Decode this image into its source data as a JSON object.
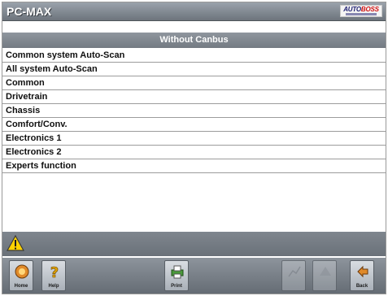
{
  "app": {
    "title": "PC-MAX",
    "brand": {
      "name_part1": "AUTO",
      "name_part2": "BOSS"
    }
  },
  "section": {
    "title": "Without Canbus"
  },
  "menu": {
    "items": [
      {
        "label": "Common system Auto-Scan"
      },
      {
        "label": "All system Auto-Scan"
      },
      {
        "label": "Common"
      },
      {
        "label": "Drivetrain"
      },
      {
        "label": "Chassis"
      },
      {
        "label": "Comfort/Conv."
      },
      {
        "label": "Electronics 1"
      },
      {
        "label": "Electronics 2"
      },
      {
        "label": "Experts function"
      }
    ]
  },
  "status": {
    "icon": "warning-icon"
  },
  "toolbar": {
    "buttons": [
      {
        "label": "Home",
        "icon": "home-icon",
        "enabled": true
      },
      {
        "label": "Help",
        "icon": "help-icon",
        "enabled": true
      },
      {
        "label": "Print",
        "icon": "print-icon",
        "enabled": true
      },
      {
        "label": "",
        "icon": "chart-icon",
        "enabled": false
      },
      {
        "label": "",
        "icon": "up-icon",
        "enabled": false
      },
      {
        "label": "Back",
        "icon": "back-icon",
        "enabled": true
      }
    ]
  },
  "colors": {
    "header_bg": "#7f868e",
    "warning": "#ffd200",
    "brand_red": "#d01010",
    "brand_blue": "#1a1a6e"
  }
}
